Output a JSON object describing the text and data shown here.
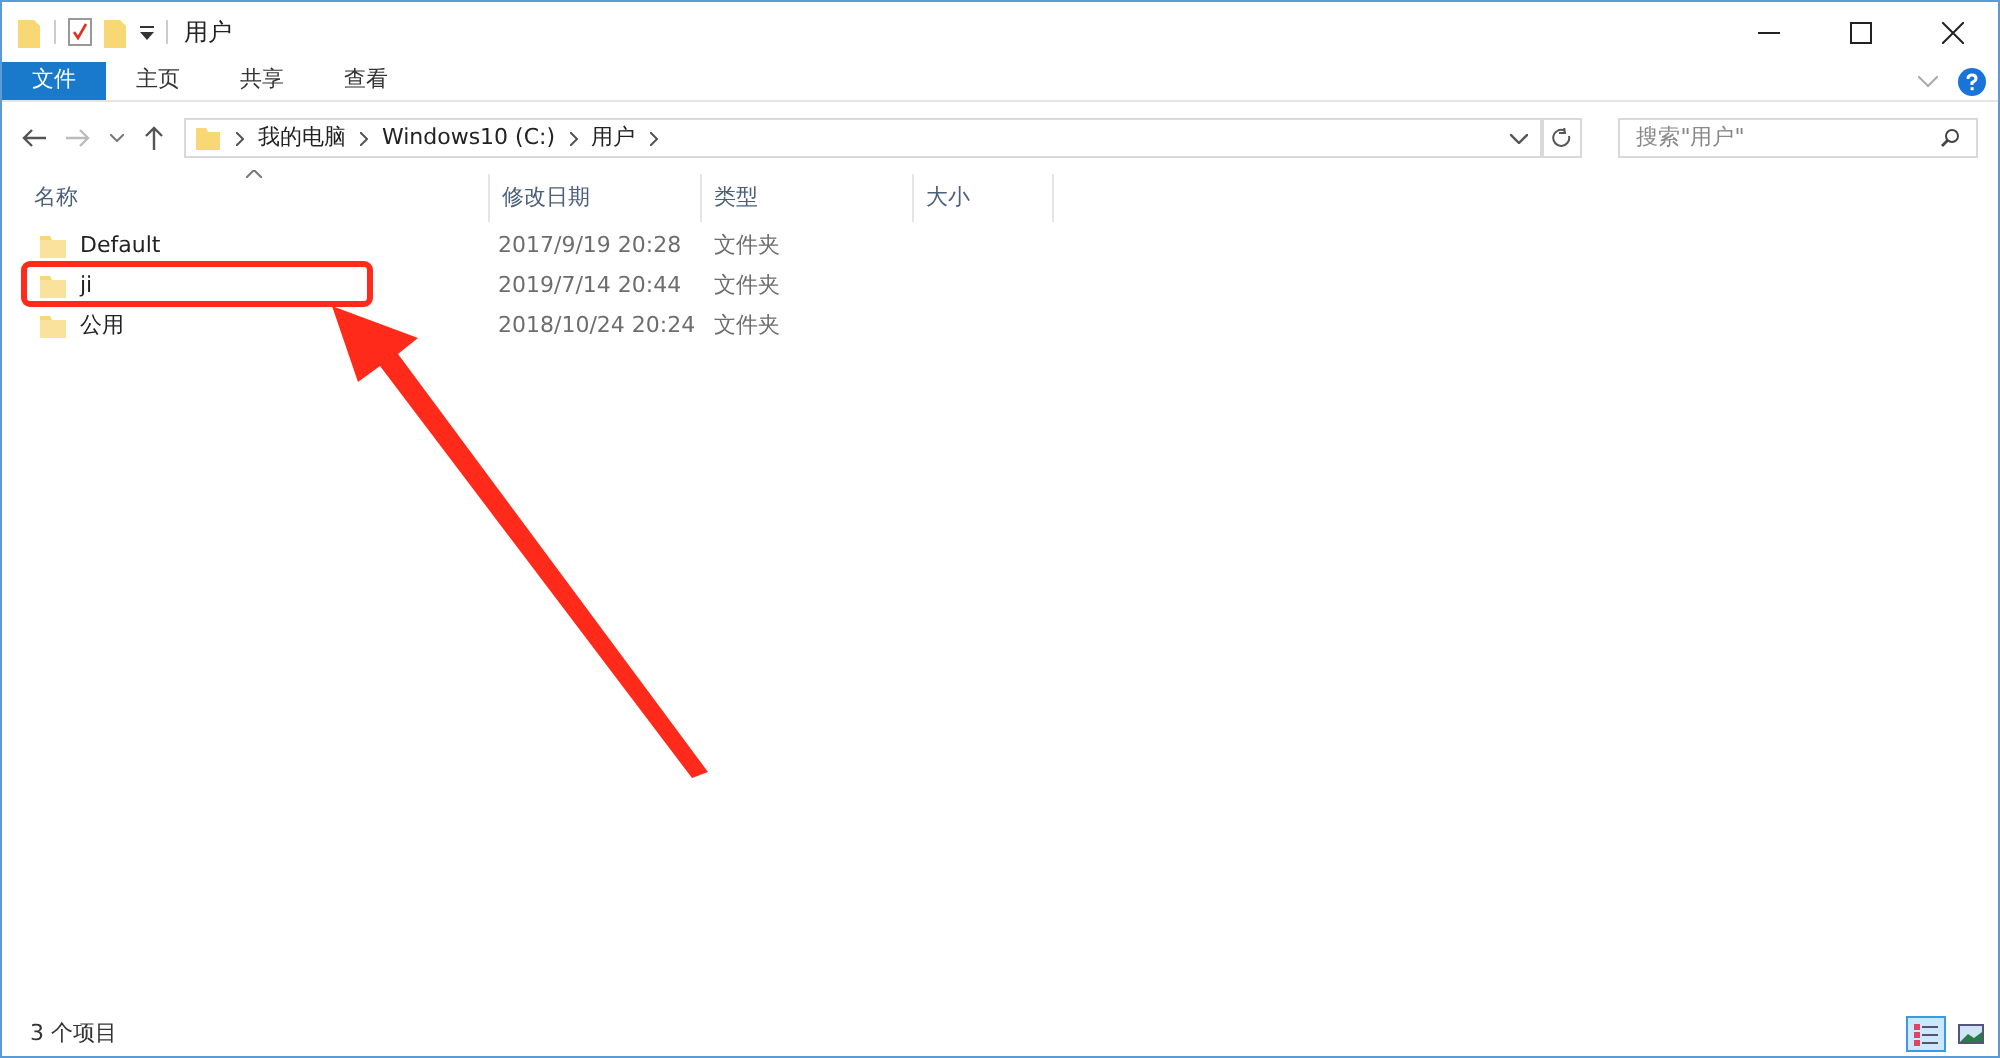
{
  "window": {
    "title": "用户"
  },
  "ribbon_tabs": [
    {
      "label": "文件",
      "selected": true
    },
    {
      "label": "主页",
      "selected": false
    },
    {
      "label": "共享",
      "selected": false
    },
    {
      "label": "查看",
      "selected": false
    }
  ],
  "address_bar": {
    "path": [
      "我的电脑",
      "Windows10 (C:)",
      "用户"
    ]
  },
  "search": {
    "placeholder": "搜索\"用户\""
  },
  "table": {
    "columns": [
      "名称",
      "修改日期",
      "类型",
      "大小"
    ],
    "rows": [
      {
        "name": "Default",
        "modified": "2017/9/19 20:28",
        "type": "文件夹"
      },
      {
        "name": "ji",
        "modified": "2019/7/14 20:44",
        "type": "文件夹"
      },
      {
        "name": "公用",
        "modified": "2018/10/24 20:24",
        "type": "文件夹"
      }
    ]
  },
  "status_bar": {
    "count": "3 个项目"
  },
  "view_buttons": [
    {
      "kind": "details",
      "selected": true
    },
    {
      "kind": "thumbnails",
      "selected": false
    }
  ]
}
